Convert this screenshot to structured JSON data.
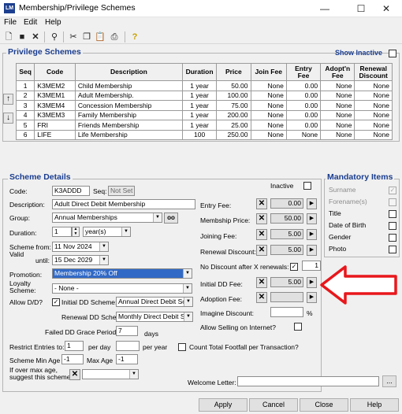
{
  "window": {
    "title": "Membership/Privilege Schemes",
    "icon_text": "LM",
    "minimize": "—",
    "maximize": "☐",
    "close": "✕"
  },
  "menu": [
    "File",
    "Edit",
    "Help"
  ],
  "toolbar_icons": [
    "new-document-icon",
    "save-icon",
    "delete-icon",
    "find-icon",
    "cut-icon",
    "copy-icon",
    "paste-icon",
    "print-icon",
    "help-icon"
  ],
  "privilege": {
    "title": "Privilege Schemes",
    "show_inactive": "Show Inactive",
    "columns": [
      "Seq",
      "Code",
      "Description",
      "Duration",
      "Price",
      "Join Fee",
      "Entry Fee",
      "Adopt'n Fee",
      "Renewal Discount"
    ],
    "rows": [
      [
        "1",
        "K3MEM2",
        "Child Membership",
        "1 year",
        "50.00",
        "None",
        "0.00",
        "None",
        "None"
      ],
      [
        "2",
        "K3MEM1",
        "Adult Membership.",
        "1 year",
        "100.00",
        "None",
        "0.00",
        "None",
        "None"
      ],
      [
        "3",
        "K3MEM4",
        "Concession Membership",
        "1 year",
        "75.00",
        "None",
        "0.00",
        "None",
        "None"
      ],
      [
        "4",
        "K3MEM3",
        "Family Membership",
        "1 year",
        "200.00",
        "None",
        "0.00",
        "None",
        "None"
      ],
      [
        "5",
        "FRI",
        "Friends Membership",
        "1 year",
        "25.00",
        "None",
        "0.00",
        "None",
        "None"
      ],
      [
        "6",
        "LIFE",
        "Life Membership",
        "100",
        "250.00",
        "None",
        "None",
        "None",
        "None"
      ]
    ]
  },
  "details": {
    "title": "Scheme Details",
    "code_label": "Code:",
    "code_value": "K3ADDD",
    "seq_label": "Seq:",
    "seq_value": "Not Set",
    "inactive_label": "Inactive",
    "description_label": "Description:",
    "description_value": "Adult Direct Debit Membership",
    "group_label": "Group:",
    "group_value": "Annual Memberships",
    "duration_label": "Duration:",
    "duration_value": "1",
    "duration_unit": "year(s)",
    "scheme_from_label": "Scheme from:",
    "scheme_from_value": "11 Nov 2024",
    "valid_label": "Valid",
    "until_label": "until:",
    "until_value": "15 Dec 2029",
    "promotion_label": "Promotion:",
    "promotion_value": "Membership 20% Off",
    "loyalty_label": "Loyalty Scheme:",
    "loyalty_value": "- None -",
    "allow_dd_label": "Allow D/D?",
    "initial_dd_scheme_label": "Initial DD Scheme:",
    "initial_dd_scheme_value": "Annual Direct Debit Sc",
    "renewal_dd_scheme_label": "Renewal DD Scheme:",
    "renewal_dd_scheme_value": "Monthly Direct Debit S",
    "failed_dd_label": "Failed DD Grace Period:",
    "failed_dd_value": "7",
    "failed_dd_unit": "days",
    "restrict_label": "Restrict Entries to:",
    "restrict_day_value": "1",
    "per_day": "per day",
    "per_year": "per year",
    "count_footfall_label": "Count Total Footfall per Transaction?",
    "min_age_label": "Scheme Min Age",
    "min_age_value": "-1",
    "max_age_label": "Max Age",
    "max_age_value": "-1",
    "over_max_label": "If over max age, suggest this scheme",
    "entry_fee_label": "Entry Fee:",
    "entry_fee_value": "0.00",
    "membership_price_label": "Membship Price:",
    "membership_price_value": "50.00",
    "joining_fee_label": "Joining Fee:",
    "joining_fee_value": "5.00",
    "renewal_discount_label": "Renewal Discount:",
    "renewal_discount_value": "5.00",
    "no_discount_label": "No Discount after X renewals:",
    "no_discount_value": "1",
    "initial_dd_fee_label": "Initial DD Fee:",
    "initial_dd_fee_value": "5.00",
    "adoption_fee_label": "Adoption Fee:",
    "imagine_discount_label": "Imagine Discount:",
    "percent": "%",
    "allow_selling_label": "Allow Selling on Internet?",
    "welcome_letter_label": "Welcome Letter:",
    "ellipsis": "..."
  },
  "mandatory": {
    "title": "Mandatory Items",
    "items": [
      "Surname",
      "Forename(s)",
      "Title",
      "Date of Birth",
      "Gender",
      "Photo"
    ]
  },
  "buttons": {
    "apply": "Apply",
    "cancel": "Cancel",
    "close": "Close",
    "help": "Help"
  },
  "colors": {
    "accent": "#1a3d8f",
    "highlight": "#3169c6",
    "arrow": "#e8171c"
  }
}
